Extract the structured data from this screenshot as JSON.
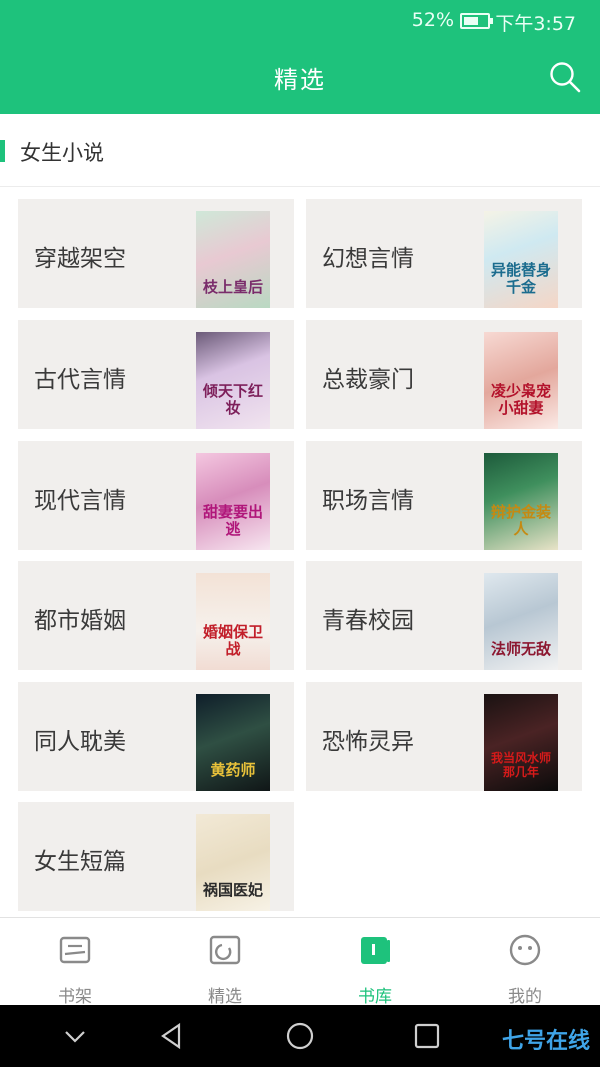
{
  "status": {
    "battery": "52%",
    "time": "下午3:57"
  },
  "header": {
    "title": "精选"
  },
  "section": {
    "title": "女生小说"
  },
  "categories": [
    {
      "label": "穿越架空",
      "cover_text": "枝上皇后"
    },
    {
      "label": "幻想言情",
      "cover_text": "异能替身千金"
    },
    {
      "label": "古代言情",
      "cover_text": "倾天下红妆"
    },
    {
      "label": "总裁豪门",
      "cover_text": "凌少枭宠小甜妻"
    },
    {
      "label": "现代言情",
      "cover_text": "甜妻要出逃"
    },
    {
      "label": "职场言情",
      "cover_text": "辩护金装人"
    },
    {
      "label": "都市婚姻",
      "cover_text": "婚姻保卫战"
    },
    {
      "label": "青春校园",
      "cover_text": "法师无敌"
    },
    {
      "label": "同人耽美",
      "cover_text": "黄药师"
    },
    {
      "label": "恐怖灵异",
      "cover_text": "我当风水师那几年"
    },
    {
      "label": "女生短篇",
      "cover_text": "祸国医妃"
    }
  ],
  "nav": [
    {
      "label": "书架",
      "icon": "bookshelf-icon"
    },
    {
      "label": "精选",
      "icon": "featured-icon"
    },
    {
      "label": "书库",
      "icon": "library-icon"
    },
    {
      "label": "我的",
      "icon": "profile-icon"
    }
  ],
  "watermark": "七号在线",
  "colors": {
    "accent": "#1ec27c",
    "card_bg": "#f1efed",
    "nav_inactive": "#8a8a8a"
  }
}
